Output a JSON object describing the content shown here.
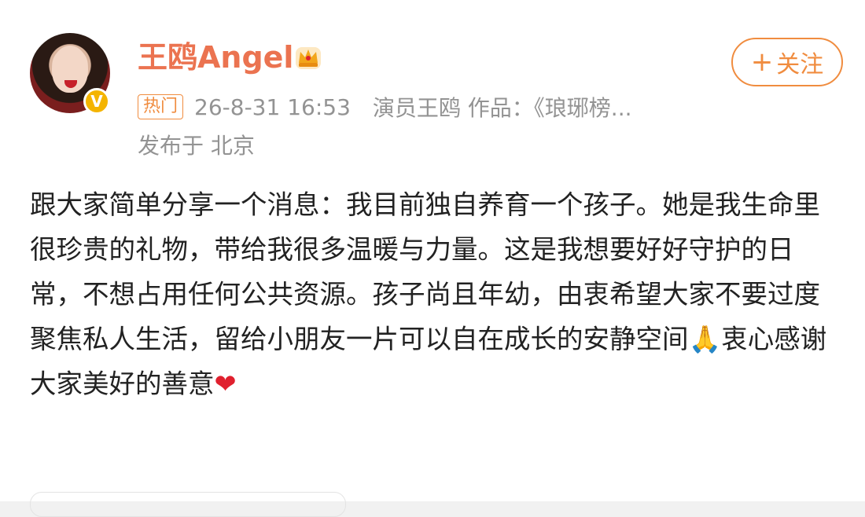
{
  "user": {
    "name": "王鸥Angel",
    "crown_icon": "crown-icon",
    "badge_icon": "verified-v-icon"
  },
  "follow_button": {
    "plus": "+",
    "label": "关注"
  },
  "meta": {
    "hot_tag": "热门",
    "timestamp": "26-8-31 16:53",
    "description": "演员王鸥 作品：《琅琊榜...",
    "location": "发布于 北京"
  },
  "post": {
    "text": "跟大家简单分享一个消息：我目前独自养育一个孩子。她是我生命里很珍贵的礼物，带给我很多温暖与力量。这是我想要好好守护的日常，不想占用任何公共资源。孩子尚且年幼，由衷希望大家不要过度聚焦私人生活，留给小朋友一片可以自在成长的安静空间",
    "emoji_pray": "🙏",
    "text_after": "衷心感谢大家美好的善意",
    "emoji_heart": "❤"
  },
  "colors": {
    "username": "#eb7350",
    "accent": "#f08c3f",
    "meta": "#939393",
    "body_text": "#222222"
  }
}
